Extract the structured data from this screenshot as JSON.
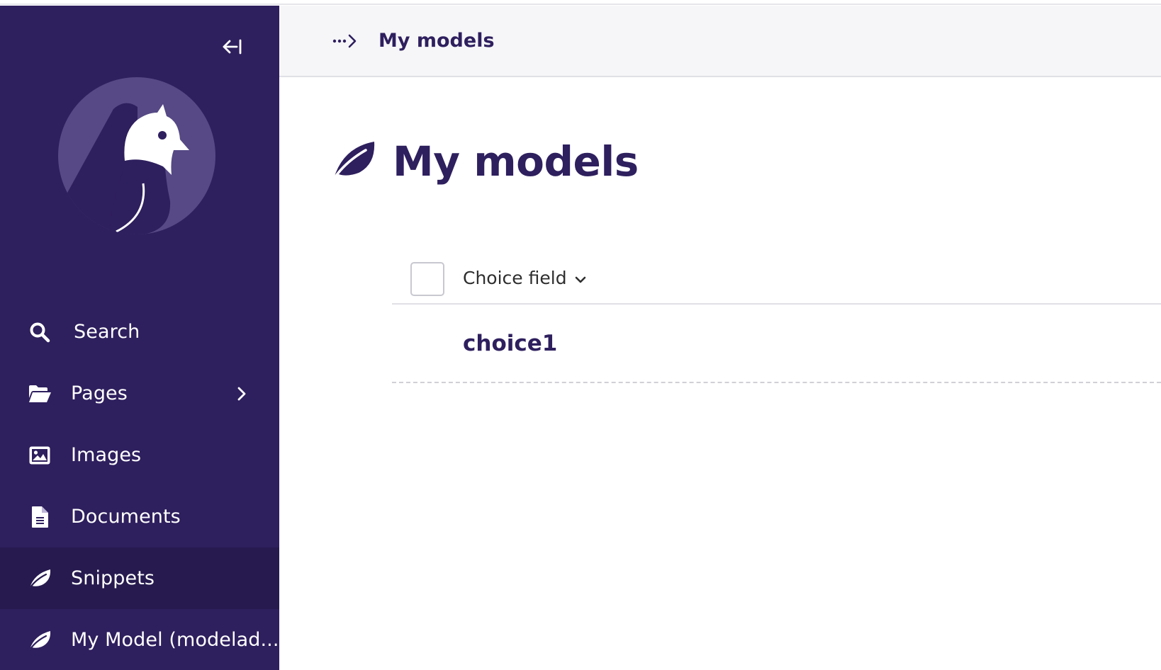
{
  "colors": {
    "sidebar_bg": "#2e1f5e",
    "sidebar_active_bg": "#261a4f",
    "header_bg": "#f6f6f8",
    "primary_text": "#2e1f5e",
    "logo_circle": "#564985"
  },
  "sidebar": {
    "collapse_icon": "collapse-left-icon",
    "logo_icon": "bird-logo",
    "items": [
      {
        "label": "Search",
        "icon": "search-icon"
      },
      {
        "label": "Pages",
        "icon": "folder-open-icon",
        "has_submenu": true
      },
      {
        "label": "Images",
        "icon": "image-icon"
      },
      {
        "label": "Documents",
        "icon": "document-icon"
      },
      {
        "label": "Snippets",
        "icon": "snippet-leaf-icon",
        "active": true
      },
      {
        "label": "My Model (modelad...",
        "icon": "snippet-leaf-icon"
      }
    ]
  },
  "header": {
    "breadcrumb_toggle_icon": "ellipsis-arrow-icon",
    "breadcrumb_current": "My models"
  },
  "main": {
    "title": "My models",
    "title_icon": "snippet-leaf-icon",
    "table": {
      "columns": [
        {
          "label": "Choice field",
          "sortable": true
        }
      ],
      "rows": [
        {
          "choice_field": "choice1"
        }
      ]
    }
  }
}
